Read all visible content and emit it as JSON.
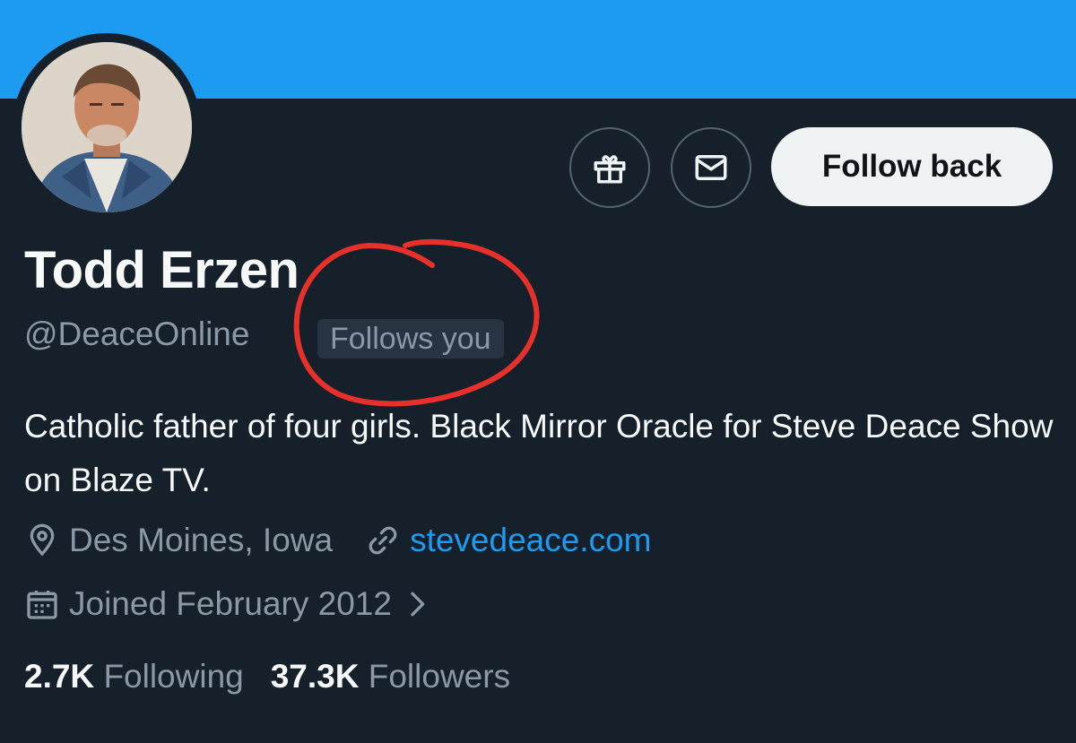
{
  "profile": {
    "display_name": "Todd Erzen",
    "handle": "@DeaceOnline",
    "follows_you_badge": "Follows you",
    "bio": "Catholic father of four girls. Black Mirror Oracle for Steve Deace Show on Blaze TV.",
    "location": "Des Moines, Iowa",
    "website": "stevedeace.com",
    "joined": "Joined February 2012",
    "following_count": "2.7K",
    "following_label": "Following",
    "followers_count": "37.3K",
    "followers_label": "Followers"
  },
  "actions": {
    "follow_back_label": "Follow back",
    "gift_icon": "gift-icon",
    "message_icon": "mail-icon"
  },
  "colors": {
    "background": "#15202b",
    "banner": "#1d9bf0",
    "accent_link": "#1d9bf0",
    "secondary_text": "#8b98a5",
    "annotation": "#e8302a"
  }
}
